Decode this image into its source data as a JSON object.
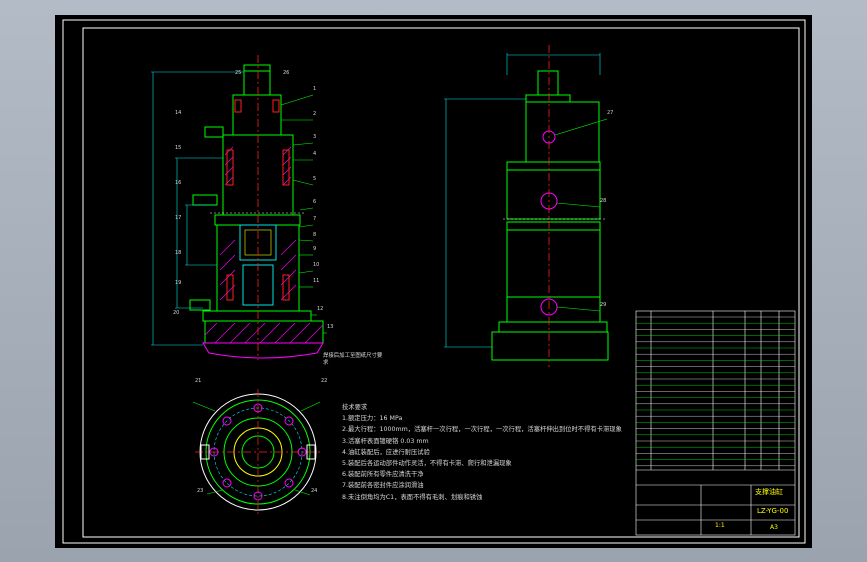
{
  "drawing": {
    "title_block": {
      "drawing_title": "支撑油缸",
      "drawing_number": "LZ-YG-00",
      "scale": "1:1",
      "sheet_size": "A3"
    },
    "technical_requirements": {
      "heading": "技术要求",
      "items": [
        "1.额定压力：16 MPa",
        "2.最大行程：1000mm，活塞杆一次行程，一次行程，一次行程，活塞杆伸出到位时不得有卡滞现象",
        "3.活塞杆表面镀硬铬 0.03 mm",
        "4.油缸装配后，应进行耐压试验",
        "5.装配后各运动部件动作灵活，不得有卡滞、爬行和泄漏现象",
        "6.装配前所有零件应清洗干净",
        "7.装配前各密封件应涂润滑油",
        "8.未注倒角均为C1，表面不得有毛刺、划痕和锈蚀"
      ]
    },
    "callouts": {
      "left_view": [
        "1",
        "2",
        "3",
        "4",
        "5",
        "6",
        "7",
        "8",
        "9",
        "10",
        "11",
        "12",
        "13",
        "14",
        "15",
        "16",
        "17",
        "18",
        "19",
        "20",
        "21",
        "22",
        "23",
        "24",
        "25",
        "26"
      ],
      "right_view": [
        "27",
        "28",
        "29"
      ]
    },
    "note_label": "焊接后加工至图纸尺寸要求"
  },
  "colors": {
    "background": "#000000",
    "frame": "#ffffff",
    "outline": "#00ff00",
    "dimension": "#00e5e5",
    "centerline": "#ff2020",
    "hatch": "#ff00ff",
    "text": "#d8d8d8",
    "leader": "#ffff00"
  }
}
